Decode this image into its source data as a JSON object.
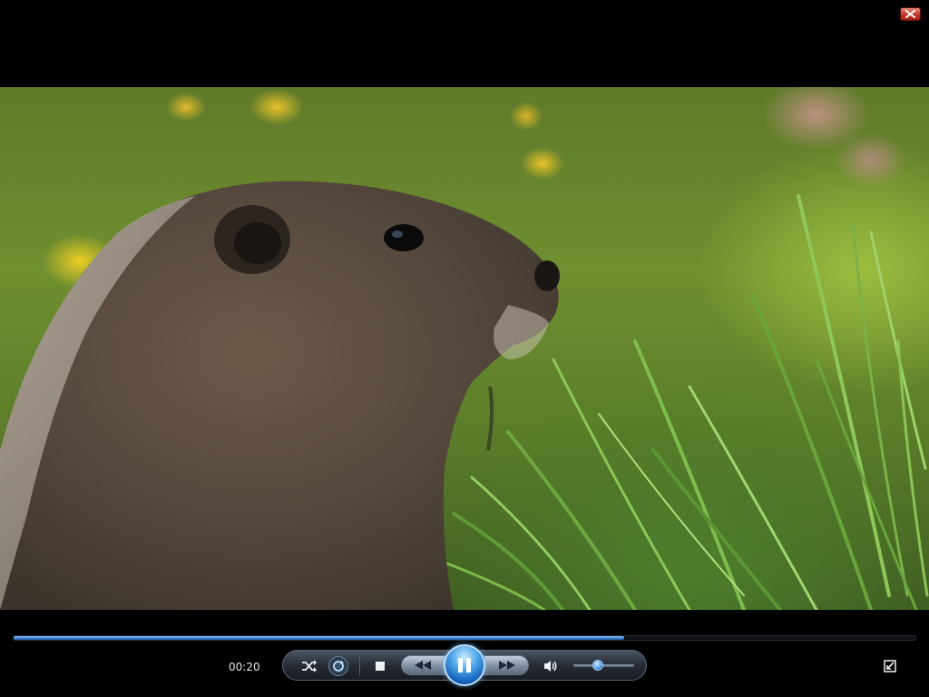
{
  "window": {
    "close_icon": "close-icon",
    "close_color": "#c2382a"
  },
  "video": {
    "content": "marmot-in-meadow"
  },
  "player": {
    "current_time": "00:20",
    "seek_progress_fraction": 0.677,
    "volume_fraction": 0.4,
    "accent_color": "#3a7fd4",
    "controls": {
      "shuffle_icon": "shuffle-icon",
      "repeat_icon": "repeat-icon",
      "stop_icon": "stop-icon",
      "previous_icon": "rewind-icon",
      "play_pause_icon": "pause-icon",
      "next_icon": "fast-forward-icon",
      "mute_icon": "speaker-icon",
      "restore_icon": "restore-window-icon"
    }
  }
}
